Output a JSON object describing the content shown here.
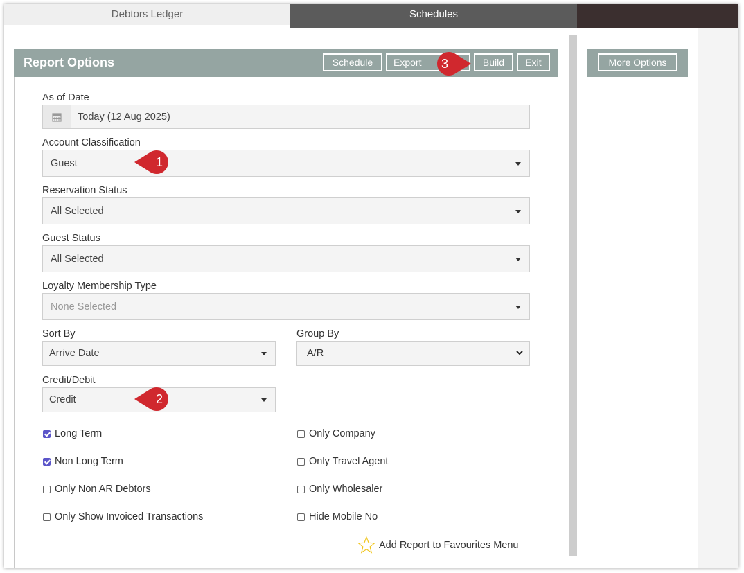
{
  "tabs": {
    "ledger": "Debtors Ledger",
    "schedules": "Schedules"
  },
  "panel": {
    "title": "Report Options",
    "buttons": {
      "schedule": "Schedule",
      "export": "Export",
      "build": "Build",
      "exit": "Exit"
    }
  },
  "side": {
    "more_options": "More Options"
  },
  "fields": {
    "as_of_date": {
      "label": "As of Date",
      "value": "Today (12 Aug 2025)"
    },
    "account_classification": {
      "label": "Account Classification",
      "value": "Guest"
    },
    "reservation_status": {
      "label": "Reservation Status",
      "value": "All Selected"
    },
    "guest_status": {
      "label": "Guest Status",
      "value": "All Selected"
    },
    "loyalty_type": {
      "label": "Loyalty Membership Type",
      "value": "None Selected"
    },
    "sort_by": {
      "label": "Sort By",
      "value": "Arrive Date"
    },
    "group_by": {
      "label": "Group By",
      "value": "A/R"
    },
    "credit_debit": {
      "label": "Credit/Debit",
      "value": "Credit"
    }
  },
  "checkboxes": {
    "long_term": {
      "label": "Long Term",
      "checked": true
    },
    "non_long_term": {
      "label": "Non Long Term",
      "checked": true
    },
    "only_non_ar": {
      "label": "Only Non AR Debtors",
      "checked": false
    },
    "only_invoiced": {
      "label": "Only Show Invoiced Transactions",
      "checked": false
    },
    "only_company": {
      "label": "Only Company",
      "checked": false
    },
    "only_travel_agent": {
      "label": "Only Travel Agent",
      "checked": false
    },
    "only_wholesaler": {
      "label": "Only Wholesaler",
      "checked": false
    },
    "hide_mobile": {
      "label": "Hide Mobile No",
      "checked": false
    }
  },
  "favourites": {
    "label": "Add Report to Favourites Menu"
  },
  "callouts": {
    "one": "1",
    "two": "2",
    "three": "3"
  },
  "colors": {
    "header": "#95a5a2",
    "callout": "#d0282e",
    "checkbox": "#5b55c9",
    "tab_active": "#5b5b5b"
  },
  "icons": {
    "calendar": "calendar-icon",
    "star": "star-icon",
    "caret": "caret-down-icon",
    "chevron": "chevron-down-icon"
  }
}
